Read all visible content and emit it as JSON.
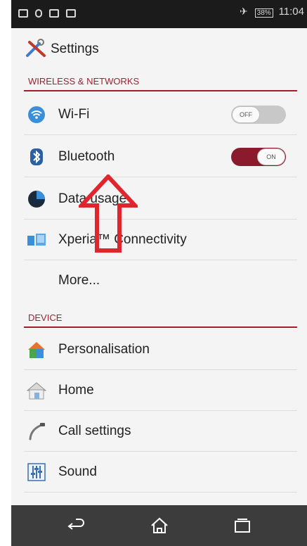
{
  "status_bar": {
    "battery": "38%",
    "time": "11:04"
  },
  "app_bar": {
    "title": "Settings",
    "icon": "settings-tools-icon"
  },
  "sections": {
    "wireless": "WIRELESS & NETWORKS",
    "device": "DEVICE"
  },
  "items": {
    "wifi": {
      "label": "Wi-Fi",
      "toggle": "OFF",
      "icon": "wifi-icon"
    },
    "bluetooth": {
      "label": "Bluetooth",
      "toggle": "ON",
      "icon": "bluetooth-icon"
    },
    "data_usage": {
      "label": "Data usage",
      "icon": "data-usage-icon"
    },
    "xperia": {
      "label": "Xperia™ Connectivity",
      "icon": "xperia-connectivity-icon"
    },
    "more": {
      "label": "More..."
    },
    "personalisation": {
      "label": "Personalisation",
      "icon": "personalisation-icon"
    },
    "home": {
      "label": "Home",
      "icon": "home-icon"
    },
    "call": {
      "label": "Call settings",
      "icon": "call-icon"
    },
    "sound": {
      "label": "Sound",
      "icon": "sound-icon"
    }
  },
  "nav": [
    "back-icon",
    "home-icon",
    "recent-apps-icon"
  ],
  "colors": {
    "accent": "#8c1a2d",
    "annotation": "#e1252c"
  }
}
